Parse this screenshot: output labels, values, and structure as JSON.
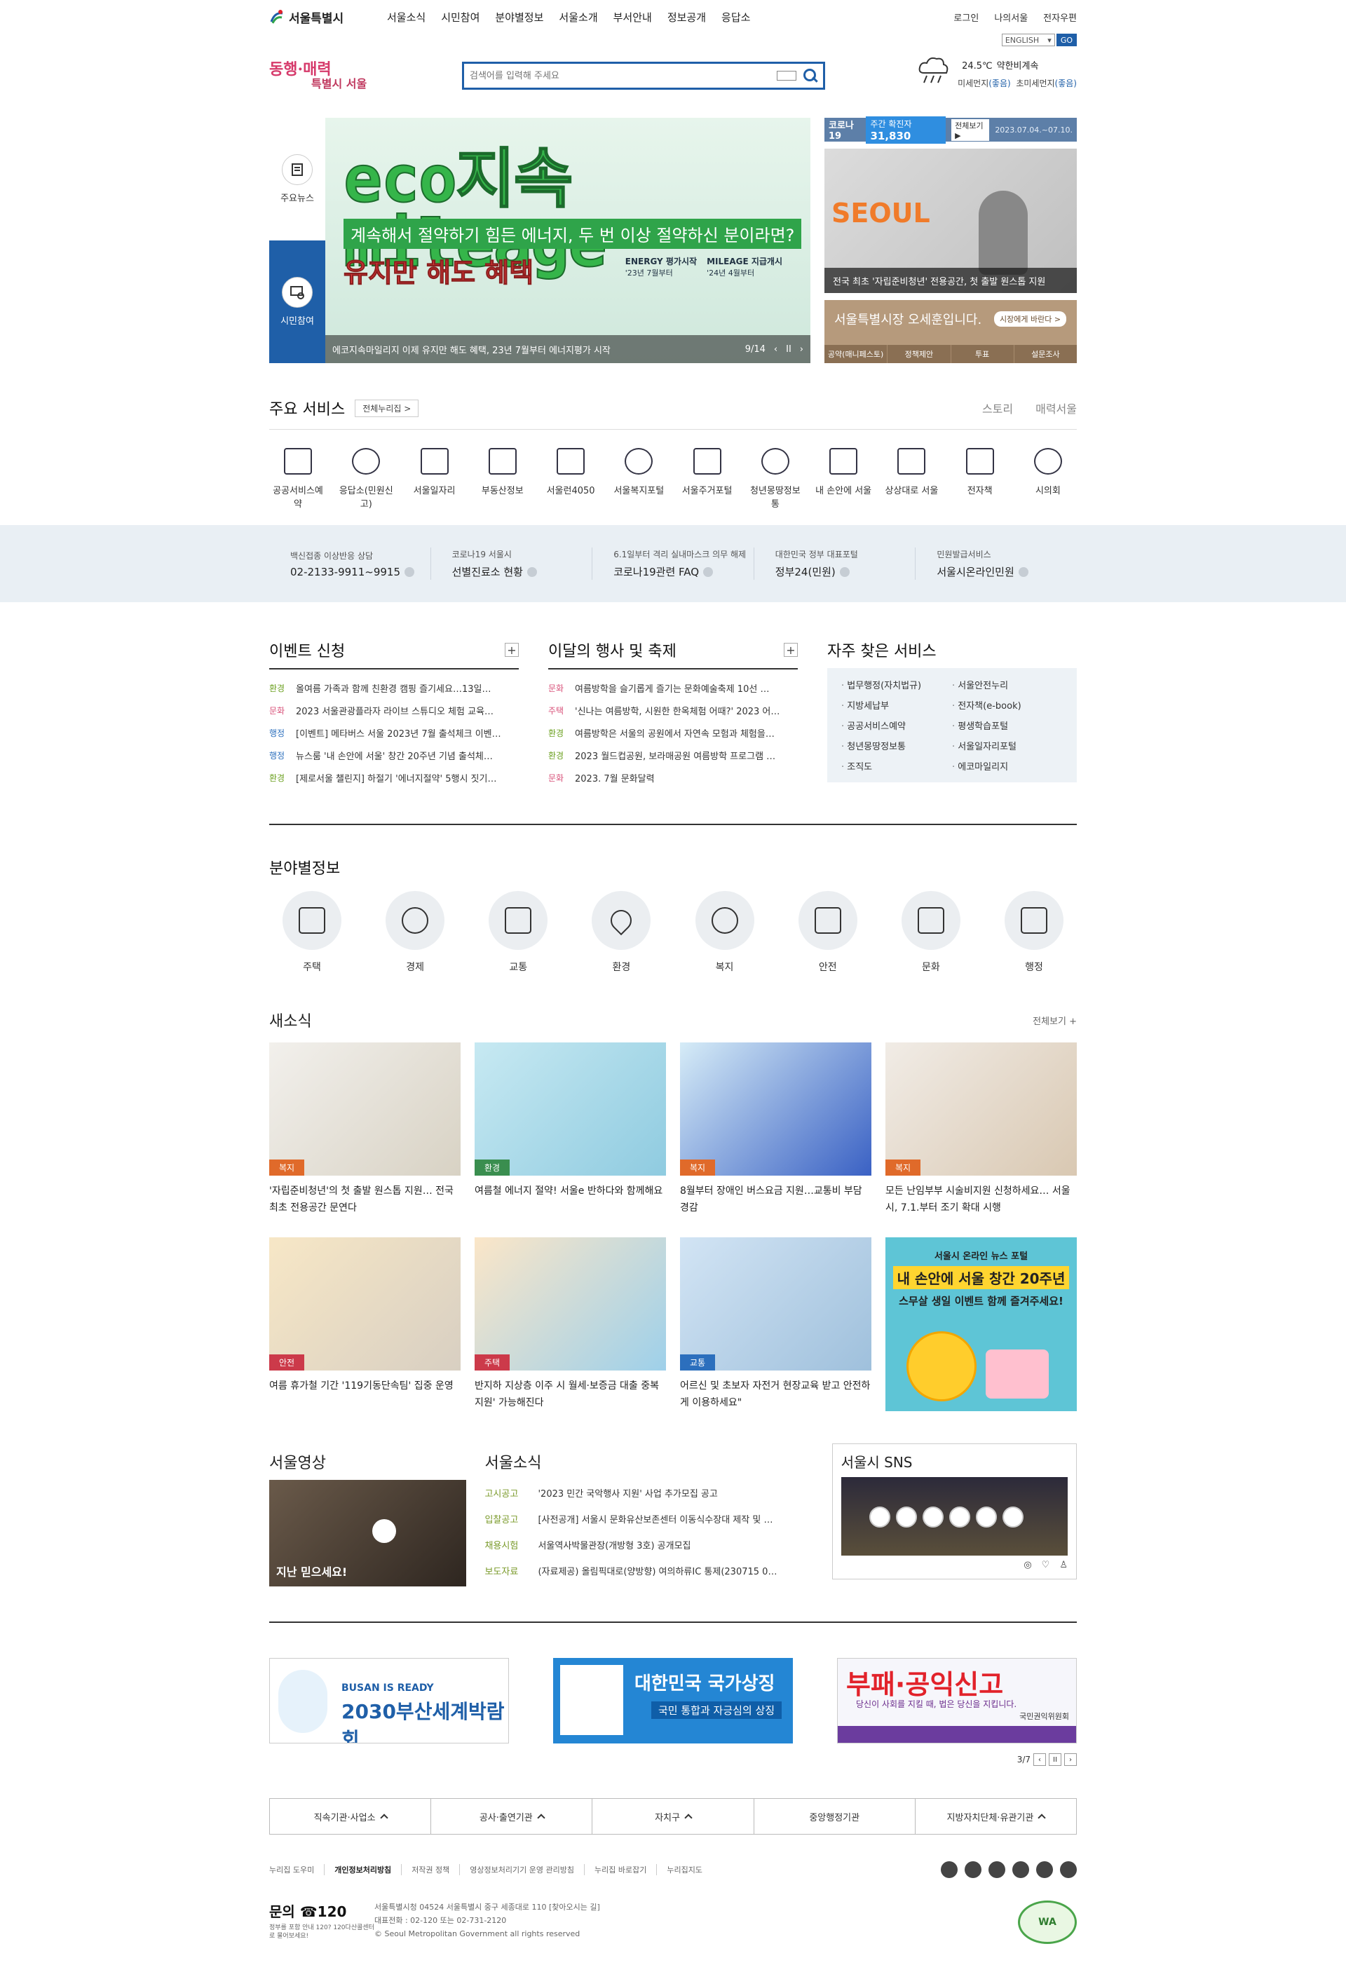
{
  "header": {
    "logo": "서울특별시",
    "nav": [
      "서울소식",
      "시민참여",
      "분야별정보",
      "서울소개",
      "부서안내",
      "정보공개",
      "응답소"
    ],
    "util": [
      "로그인",
      "나의서울",
      "전자우편"
    ],
    "lang": "ENGLISH",
    "go": "GO",
    "slogan_top": "동행·매력",
    "slogan_bottom": "특별시 서울",
    "search_placeholder": "검색어를 입력해 주세요",
    "weather": {
      "temp": "24.5℃",
      "desc": "약한비계속",
      "dust_label": "미세먼지",
      "dust_val": "(좋음)",
      "ultra_label": "초미세먼지",
      "ultra_val": "(좋음)"
    }
  },
  "hero": {
    "tab_news": "주요뉴스",
    "tab_civic": "시민참여",
    "title": "eco지속mileage",
    "subtitle": "계속해서 절약하기 힘든 에너지, 두 번 이상 절약하신 분이라면?",
    "highlight": "유지만 해도 혜택",
    "meta1_title": "ENERGY 평가시작",
    "meta1_sub": "'23년 7월부터",
    "meta2_title": "MILEAGE 지급개시",
    "meta2_sub": "'24년 4월부터",
    "caption": "에코지속마일리지 이제 유지만 해도 혜택, 23년 7월부터 에너지평가 시작",
    "pager": "9/14",
    "prev": "‹",
    "pause": "II",
    "next": "›"
  },
  "covid": {
    "label": "코로나19",
    "weekly_label": "주간 확진자",
    "weekly_count": "31,830",
    "view_all": "전체보기 ▶",
    "period": "2023.07.04.~07.10."
  },
  "press": {
    "brand": "SEOUL",
    "caption": "전국 최초 '자립준비청년' 전용공간, 첫 출발 원스톱 지원"
  },
  "mayor": {
    "title": "서울특별시장 오세훈입니다.",
    "msg": "시장에게 바란다 >",
    "links": [
      "공약(매니페스토)",
      "정책제안",
      "투표",
      "설문조사"
    ]
  },
  "services": {
    "title": "주요 서비스",
    "all": "전체누리집 >",
    "brands": [
      "스토리",
      "매력서울"
    ],
    "items": [
      "공공서비스예약",
      "응답소(민원신고)",
      "서울일자리",
      "부동산정보",
      "서울런4050",
      "서울복지포털",
      "서울주거포털",
      "청년몽땅정보통",
      "내 손안에 서울",
      "상상대로 서울",
      "전자책",
      "시의회"
    ]
  },
  "quick": [
    {
      "t": "백신접종 이상반응 상담",
      "v": "02-2133-9911~9915"
    },
    {
      "t": "코로나19 서울시",
      "v": "선별진료소 현황"
    },
    {
      "t": "6.1일부터 격리 실내마스크 의무 해제",
      "v": "코로나19관련 FAQ"
    },
    {
      "t": "대한민국 정부 대표포털",
      "v": "정부24(민원)"
    },
    {
      "t": "민원발급서비스",
      "v": "서울시온라인민원"
    }
  ],
  "events": {
    "title": "이벤트 신청",
    "plus": "+",
    "items": [
      {
        "cat": "환경",
        "text": "올여름 가족과 함께 친환경 캠핑 즐기세요…13일…"
      },
      {
        "cat": "문화",
        "text": "2023 서울관광플라자 라이브 스튜디오 체험 교육…"
      },
      {
        "cat": "행정",
        "text": "[이벤트] 메타버스 서울 2023년 7월 출석체크 이벤…"
      },
      {
        "cat": "행정",
        "text": "뉴스룸 '내 손안에 서울' 창간 20주년 기념 출석체…"
      },
      {
        "cat": "환경",
        "text": "[제로서울 챌린지] 하절기 '에너지절약' 5행시 짓기…"
      }
    ]
  },
  "festival": {
    "title": "이달의 행사 및 축제",
    "plus": "+",
    "items": [
      {
        "cat": "문화",
        "text": "여름방학을 슬기롭게 즐기는 문화예술축제 10선 …"
      },
      {
        "cat": "주택",
        "text": "'신나는 여름방학, 시원한 한옥체험 어때?' 2023 어…"
      },
      {
        "cat": "환경",
        "text": "여름방학은 서울의 공원에서 자연속 모험과 체험을…"
      },
      {
        "cat": "환경",
        "text": "2023 월드컵공원, 보라매공원 여름방학 프로그램 …"
      },
      {
        "cat": "문화",
        "text": "2023. 7월 문화달력"
      }
    ]
  },
  "faq": {
    "title": "자주 찾은 서비스",
    "items": [
      "법무행정(자치법규)",
      "서울안전누리",
      "지방세납부",
      "전자책(e-book)",
      "공공서비스예약",
      "평생학습포털",
      "청년몽땅정보통",
      "서울일자리포털",
      "조직도",
      "에코마일리지"
    ]
  },
  "fields": {
    "title": "분야별정보",
    "items": [
      "주택",
      "경제",
      "교통",
      "환경",
      "복지",
      "안전",
      "문화",
      "행정"
    ]
  },
  "news": {
    "title": "새소식",
    "all": "전체보기 +",
    "cards": [
      {
        "tag": "복지",
        "title": "'자립준비청년'의 첫 출발 원스톱 지원… 전국 최초 전용공간 문연다"
      },
      {
        "tag": "환경",
        "title": "여름철 에너지 절약! 서울e 반하다와 함께해요"
      },
      {
        "tag": "복지",
        "title": "8월부터 장애인 버스요금 지원…교통비 부담 경감"
      },
      {
        "tag": "복지",
        "title": "모든 난임부부 시술비지원 신청하세요… 서울시, 7.1.부터 조기 확대 시행"
      },
      {
        "tag": "안전",
        "title": "여름 휴가철 기간 '119기동단속팀' 집중 운영"
      },
      {
        "tag": "주택",
        "title": "반지하 지상층 이주 시 월세·보증금 대출 중복지원' 가능해진다"
      },
      {
        "tag": "교통",
        "title": "어르신 및 초보자 자전거 현장교육 받고 안전하게 이용하세요\""
      }
    ],
    "poster": {
      "a": "서울시 온라인 뉴스 포털",
      "b": "내 손안에 서울 창간 20주년",
      "c": "스무살 생일 이벤트 함께 즐겨주세요!"
    }
  },
  "video": {
    "title": "서울영상",
    "caption": "지난 믿으세요!"
  },
  "seoul_news": {
    "title": "서울소식",
    "items": [
      {
        "k": "고시공고",
        "v": "'2023 민간 국악행사 지원' 사업 추가모집 공고"
      },
      {
        "k": "입찰공고",
        "v": "[사전공개] 서울시 문화유산보존센터 이동식수장대 제작 및 …"
      },
      {
        "k": "채용시험",
        "v": "서울역사박물관장(개방형 3호) 공개모집"
      },
      {
        "k": "보도자료",
        "v": "(자료제공) 올림픽대로(양방향) 여의하류IC 통제(230715 0…"
      }
    ]
  },
  "sns": {
    "title": "서울시 SNS"
  },
  "banners": {
    "b1_t1": "BUSAN IS READY",
    "b1_t2": "2030부산세계박람회",
    "b2_t1": "대한민국 국가상징",
    "b2_t2": "국민 통합과 자긍심의 상징",
    "b3_t1": "부패·공익신고",
    "b3_t2": "당신이 사회를 지킬 때, 법은 당신을 지킵니다.",
    "b3_org": "국민권익위원회",
    "pager": "3/7",
    "prev": "‹",
    "pause": "II",
    "next": "›"
  },
  "footer": {
    "drops": [
      "직속기관·사업소",
      "공사·출연기관",
      "자치구",
      "중앙행정기관",
      "지방자치단체·유관기관"
    ],
    "links": [
      "누리집 도우미",
      "개인정보처리방침",
      "저작권 정책",
      "영상정보처리기기 운영 관리방침",
      "누리집 바로잡기",
      "누리집지도"
    ],
    "call_label": "문의 ☎120",
    "call_sub": "정부를 포함 안내 120?\n120다산콜센터로 물어보세요!",
    "addr1": "서울특별시청 04524 서울특별시 중구 세종대로 110 [찾아오시는 길]",
    "addr2": "대표전화 : 02-120 또는 02-731-2120",
    "copy": "© Seoul Metropolitan Government all rights reserved",
    "wa": "WA"
  }
}
